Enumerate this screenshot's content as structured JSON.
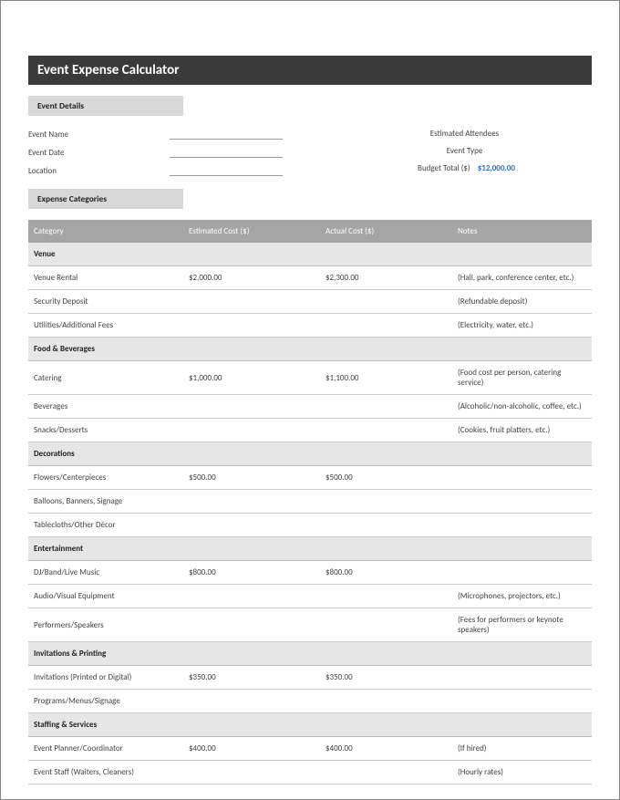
{
  "title": "Event Expense Calculator",
  "section_event_details": "Event Details",
  "section_expense_categories": "Expense Categories",
  "details_left": [
    {
      "label": "Event Name",
      "value": ""
    },
    {
      "label": "Event Date",
      "value": ""
    },
    {
      "label": "Location",
      "value": ""
    }
  ],
  "details_right": [
    {
      "label": "Estimated Attendees",
      "value": ""
    },
    {
      "label": "Event Type",
      "value": ""
    },
    {
      "label": "Budget Total ($)",
      "value": "$12,000.00",
      "is_budget": true
    }
  ],
  "columns": {
    "category": "Category",
    "estimated": "Estimated Cost ($)",
    "actual": "Actual Cost ($)",
    "notes": "Notes"
  },
  "sections": [
    {
      "name": "Venue",
      "rows": [
        {
          "item": "Venue Rental",
          "est": "$2,000.00",
          "act": "$2,300.00",
          "notes": "(Hall, park, conference center, etc.)"
        },
        {
          "item": "Security Deposit",
          "est": "",
          "act": "",
          "notes": "(Refundable deposit)"
        },
        {
          "item": "Utilities/Additional Fees",
          "est": "",
          "act": "",
          "notes": "(Electricity, water, etc.)"
        }
      ]
    },
    {
      "name": "Food & Beverages",
      "rows": [
        {
          "item": "Catering",
          "est": "$1,000.00",
          "act": "$1,100.00",
          "notes": "(Food cost per person, catering service)"
        },
        {
          "item": "Beverages",
          "est": "",
          "act": "",
          "notes": "(Alcoholic/non-alcoholic, coffee, etc.)"
        },
        {
          "item": "Snacks/Desserts",
          "est": "",
          "act": "",
          "notes": "(Cookies, fruit platters, etc.)"
        }
      ]
    },
    {
      "name": "Decorations",
      "rows": [
        {
          "item": "Flowers/Centerpieces",
          "est": "$500.00",
          "act": "$500.00",
          "notes": ""
        },
        {
          "item": "Balloons, Banners, Signage",
          "est": "",
          "act": "",
          "notes": ""
        },
        {
          "item": "Tablecloths/Other Décor",
          "est": "",
          "act": "",
          "notes": ""
        }
      ]
    },
    {
      "name": "Entertainment",
      "rows": [
        {
          "item": "DJ/Band/Live Music",
          "est": "$800.00",
          "act": "$800.00",
          "notes": ""
        },
        {
          "item": "Audio/Visual Equipment",
          "est": "",
          "act": "",
          "notes": "(Microphones, projectors, etc.)"
        },
        {
          "item": "Performers/Speakers",
          "est": "",
          "act": "",
          "notes": "(Fees for performers or keynote speakers)"
        }
      ]
    },
    {
      "name": "Invitations & Printing",
      "rows": [
        {
          "item": "Invitations (Printed or Digital)",
          "est": "$350.00",
          "act": "$350.00",
          "notes": ""
        },
        {
          "item": "Programs/Menus/Signage",
          "est": "",
          "act": "",
          "notes": ""
        }
      ]
    },
    {
      "name": "Staffing & Services",
      "rows": [
        {
          "item": "Event Planner/Coordinator",
          "est": "$400.00",
          "act": "$400.00",
          "notes": "(If hired)"
        },
        {
          "item": "Event Staff (Waiters, Cleaners)",
          "est": "",
          "act": "",
          "notes": "(Hourly rates)"
        }
      ]
    }
  ]
}
